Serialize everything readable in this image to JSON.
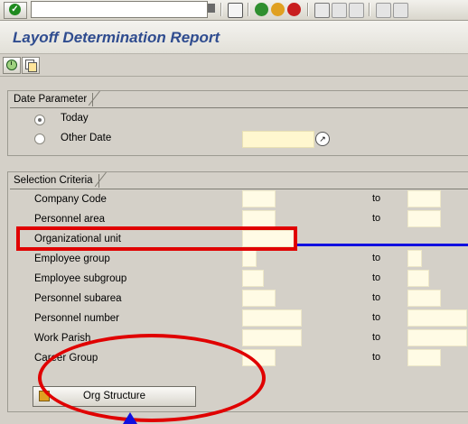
{
  "title": "Layoff Determination Report",
  "toolbar": {
    "icons": [
      "enter-icon",
      "save-icon",
      "back-icon",
      "exit-icon",
      "cancel-icon",
      "print-icon",
      "find-icon",
      "find-next-icon",
      "first-page-icon",
      "prev-page-icon"
    ]
  },
  "date_parameter": {
    "group_label": "Date Parameter",
    "options": [
      {
        "label": "Today",
        "selected": true
      },
      {
        "label": "Other Date",
        "selected": false
      }
    ]
  },
  "selection_criteria": {
    "group_label": "Selection Criteria",
    "to_label": "to",
    "rows": [
      {
        "label": "Company Code"
      },
      {
        "label": "Personnel area"
      },
      {
        "label": "Organizational unit"
      },
      {
        "label": "Employee group"
      },
      {
        "label": "Employee subgroup"
      },
      {
        "label": "Personnel subarea"
      },
      {
        "label": "Personnel number"
      },
      {
        "label": "Work Parish"
      },
      {
        "label": "Career Group"
      }
    ],
    "org_structure_button": "Org Structure"
  },
  "colors": {
    "title": "#2f4c8f",
    "annotation_red": "#e00000",
    "annotation_blue": "#1010e0",
    "input_fill": "#fff7cf"
  }
}
